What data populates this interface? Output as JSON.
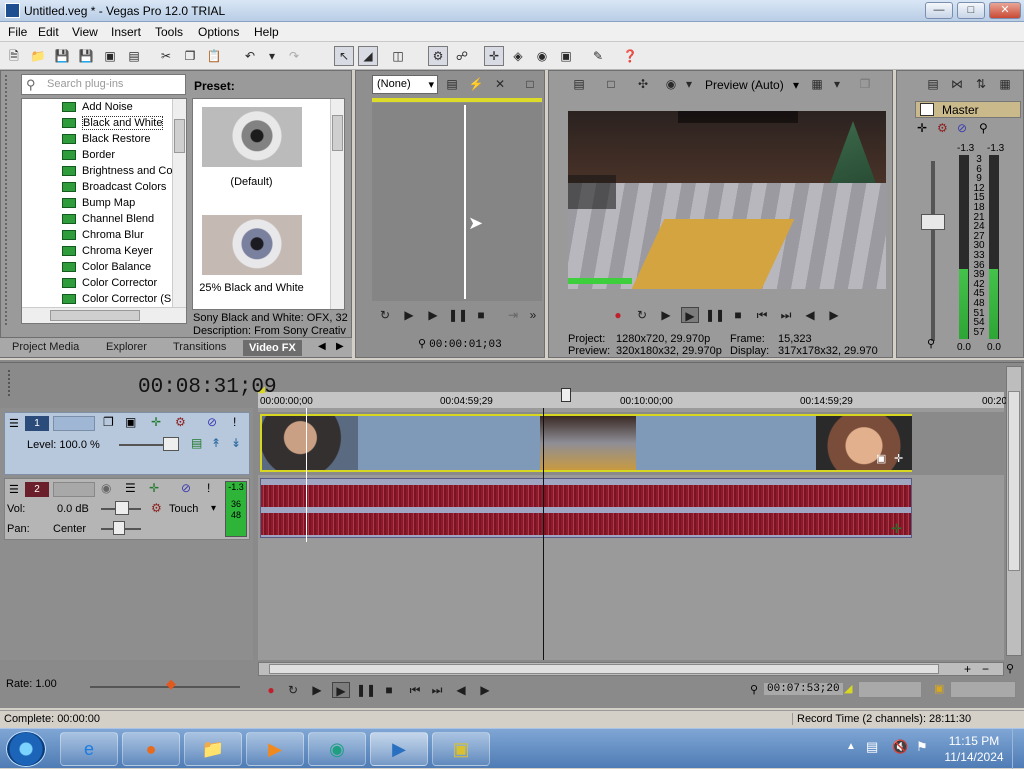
{
  "window": {
    "title": "Untitled.veg * - Vegas Pro 12.0 TRIAL"
  },
  "menu": [
    "File",
    "Edit",
    "View",
    "Insert",
    "Tools",
    "Options",
    "Help"
  ],
  "fx": {
    "search_placeholder": "Search plug-ins",
    "preset_label": "Preset:",
    "plugins": [
      "Add Noise",
      "Black and White",
      "Black Restore",
      "Border",
      "Brightness and Co",
      "Broadcast Colors",
      "Bump Map",
      "Channel Blend",
      "Chroma Blur",
      "Chroma Keyer",
      "Color Balance",
      "Color Corrector",
      "Color Corrector (S",
      "Color Curves"
    ],
    "selected": "Black and White",
    "presets": [
      "(Default)",
      "25% Black and White"
    ],
    "info_line1": "Sony Black and White: OFX, 32",
    "info_line2": "Description: From Sony Creativ"
  },
  "tabs": [
    "Project Media",
    "Explorer",
    "Transitions",
    "Video FX"
  ],
  "trimmer": {
    "select": "(None)",
    "time": "00:00:01;03"
  },
  "preview": {
    "mode": "Preview (Auto)",
    "project_label": "Project:",
    "project": "1280x720, 29.970p",
    "frame_label": "Frame:",
    "frame": "15,323",
    "preview_label": "Preview:",
    "preview_res": "320x180x32, 29.970p",
    "display_label": "Display:",
    "display": "317x178x32, 29.970"
  },
  "mixer": {
    "master": "Master",
    "peak_l": "-1.3",
    "peak_r": "-1.3",
    "ticks": [
      "3",
      "6",
      "9",
      "12",
      "15",
      "18",
      "21",
      "24",
      "27",
      "30",
      "33",
      "36",
      "39",
      "42",
      "45",
      "48",
      "51",
      "54",
      "57"
    ],
    "bottom_l": "0.0",
    "bottom_r": "0.0",
    "level_l": 0.38,
    "level_r": 0.38
  },
  "timeline": {
    "time": "00:08:31;09",
    "ruler": [
      "00:00:00;00",
      "00:04:59;29",
      "00:10:00;00",
      "00:14:59;29",
      "00:20"
    ],
    "video_track": {
      "num": "1",
      "level": "Level: 100.0 %"
    },
    "audio_track": {
      "num": "2",
      "vol_label": "Vol:",
      "vol": "0.0 dB",
      "pan_label": "Pan:",
      "pan": "Center",
      "automation": "Touch",
      "meter_top": "-1.3",
      "meter": [
        "36",
        "48"
      ]
    },
    "rate": "Rate: 1.00",
    "cursor_time": "00:07:53;20"
  },
  "status": {
    "left": "Complete: 00:00:00",
    "right": "Record Time (2 channels): 28:11:30"
  },
  "taskbar": {
    "time": "11:15 PM",
    "date": "11/14/2024"
  }
}
